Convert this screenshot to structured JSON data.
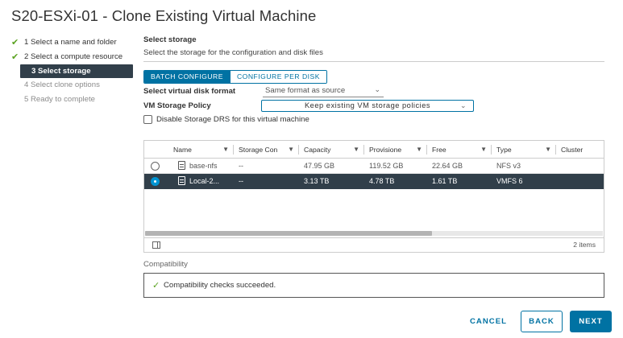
{
  "title": "S20-ESXi-01 - Clone Existing Virtual Machine",
  "steps": [
    {
      "label": "1 Select a name and folder",
      "state": "done"
    },
    {
      "label": "2 Select a compute resource",
      "state": "done"
    },
    {
      "label": "3 Select storage",
      "state": "active"
    },
    {
      "label": "4 Select clone options",
      "state": "disabled"
    },
    {
      "label": "5 Ready to complete",
      "state": "disabled"
    }
  ],
  "section": {
    "title": "Select storage",
    "subtitle": "Select the storage for the configuration and disk files"
  },
  "modes": {
    "batch": "BATCH CONFIGURE",
    "per_disk": "CONFIGURE PER DISK"
  },
  "disk_format": {
    "label": "Select virtual disk format",
    "value": "Same format as source"
  },
  "storage_policy": {
    "label": "VM Storage Policy",
    "value": "Keep existing VM storage policies"
  },
  "disable_drs": {
    "label": "Disable Storage DRS for this virtual machine",
    "checked": false
  },
  "grid": {
    "columns": [
      "Name",
      "Storage Con",
      "Capacity",
      "Provisione",
      "Free",
      "Type",
      "Cluster"
    ],
    "rows": [
      {
        "name": "base-nfs",
        "storage_compat": "--",
        "capacity": "47.95 GB",
        "provisioned": "119.52 GB",
        "free": "22.64 GB",
        "type": "NFS v3",
        "cluster": "",
        "selected": false
      },
      {
        "name": "Local-2...",
        "storage_compat": "--",
        "capacity": "3.13 TB",
        "provisioned": "4.78 TB",
        "free": "1.61 TB",
        "type": "VMFS 6",
        "cluster": "",
        "selected": true
      }
    ],
    "footer_count": "2 items"
  },
  "compatibility": {
    "label": "Compatibility",
    "message": "Compatibility checks succeeded."
  },
  "buttons": {
    "cancel": "CANCEL",
    "back": "BACK",
    "next": "NEXT"
  },
  "colors": {
    "accent": "#0072a3",
    "selected_row": "#313f4a",
    "success": "#5aa220"
  }
}
